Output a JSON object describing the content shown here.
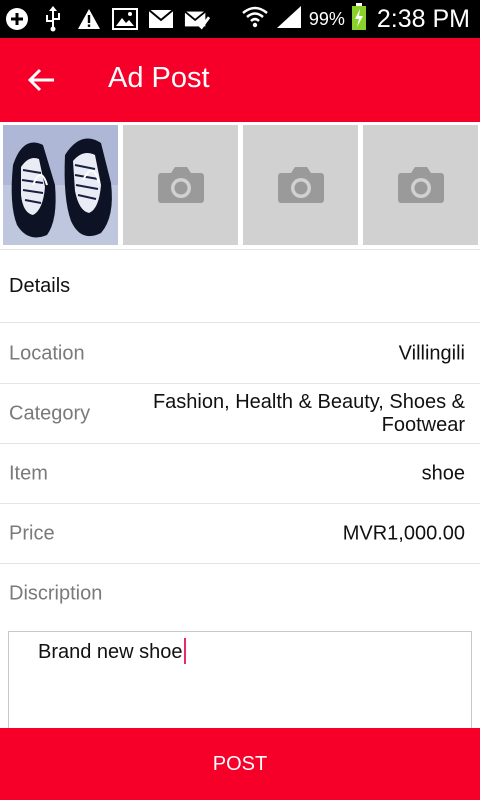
{
  "status_bar": {
    "battery_percent": "99%",
    "time": "2:38 PM",
    "icons": [
      "add-icon",
      "usb-icon",
      "warning-icon",
      "image-icon",
      "mail-icon",
      "mail-check-icon",
      "wifi-icon",
      "signal-icon",
      "battery-charging-icon"
    ]
  },
  "header": {
    "title": "Ad Post",
    "back_icon": "arrow-left-icon"
  },
  "photos": [
    {
      "type": "image",
      "description_icon": "shoe-photo"
    },
    {
      "type": "placeholder",
      "icon": "camera-icon"
    },
    {
      "type": "placeholder",
      "icon": "camera-icon"
    },
    {
      "type": "placeholder",
      "icon": "camera-icon"
    }
  ],
  "details": {
    "section_title": "Details",
    "location": {
      "label": "Location",
      "value": "Villingili"
    },
    "category": {
      "label": "Category",
      "value_line1": "Fashion, Health & Beauty, Shoes &",
      "value_line2": "Footwear"
    },
    "item": {
      "label": "Item",
      "value": "shoe"
    },
    "price": {
      "label": "Price",
      "value": "MVR1,000.00"
    },
    "description": {
      "label": "Discription",
      "value": "Brand new shoe"
    }
  },
  "actions": {
    "post_label": "POST"
  },
  "colors": {
    "accent": "#f6002a",
    "placeholder_bg": "#d1d1d1",
    "caret": "#e62a6b"
  }
}
